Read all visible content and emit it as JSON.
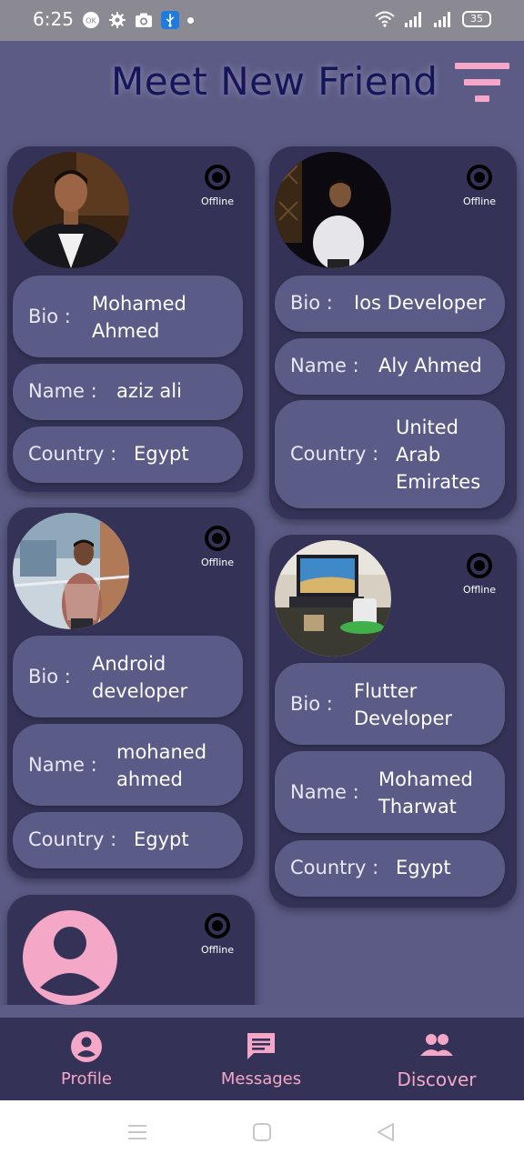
{
  "status_bar": {
    "time": "6:25",
    "battery": "35"
  },
  "app_bar": {
    "title": "Meet New Friend",
    "filter_icon": "filter-icon"
  },
  "cards": [
    {
      "status": "Offline",
      "bio_label": "Bio :",
      "bio": "Mohamed Ahmed",
      "name_label": "Name :",
      "name": "aziz ali",
      "country_label": "Country :",
      "country": "Egypt"
    },
    {
      "status": "Offline",
      "bio_label": "Bio :",
      "bio": "Ios Developer",
      "name_label": "Name :",
      "name": "Aly Ahmed",
      "country_label": "Country :",
      "country": "United Arab Emirates"
    },
    {
      "status": "Offline",
      "bio_label": "Bio :",
      "bio": "Android developer",
      "name_label": "Name :",
      "name": "mohaned ahmed",
      "country_label": "Country :",
      "country": "Egypt"
    },
    {
      "status": "Offline",
      "bio_label": "Bio :",
      "bio": "Flutter Developer",
      "name_label": "Name :",
      "name": "Mohamed Tharwat",
      "country_label": "Country :",
      "country": "Egypt"
    },
    {
      "status": "Offline"
    }
  ],
  "bottom_nav": [
    {
      "label": "Profile",
      "icon": "account-circle-icon"
    },
    {
      "label": "Messages",
      "icon": "message-icon"
    },
    {
      "label": "Discover",
      "icon": "people-icon"
    }
  ],
  "colors": {
    "background": "#5b5b86",
    "card": "#343357",
    "pill": "#5b5b88",
    "accent": "#f4a7c7",
    "title": "#15155a"
  }
}
